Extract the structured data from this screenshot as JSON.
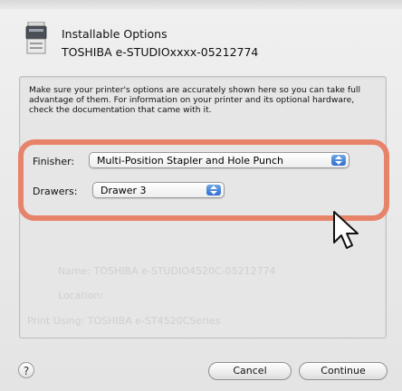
{
  "dialog": {
    "title": "Installable Options",
    "subtitle": "TOSHIBA e-STUDIOxxxx-05212774",
    "instructions": "Make sure your printer's options are accurately shown here so you can take full advantage of them.  For information on your printer and its optional hardware, check the documentation that came with it."
  },
  "options": {
    "finisher_label": "Finisher:",
    "finisher_value": "Multi-Position Stapler and Hole Punch",
    "drawers_label": "Drawers:",
    "drawers_value": "Drawer 3"
  },
  "background_fields": {
    "name": "Name:  TOSHIBA e-STUDIO4520C-05212774",
    "location": "Location:",
    "print_using": "Print Using:  TOSHIBA e-ST4520CSeries"
  },
  "buttons": {
    "help": "?",
    "cancel": "Cancel",
    "continue": "Continue"
  },
  "colors": {
    "highlight": "#e8836b",
    "stepper": "#2f6fcf"
  }
}
